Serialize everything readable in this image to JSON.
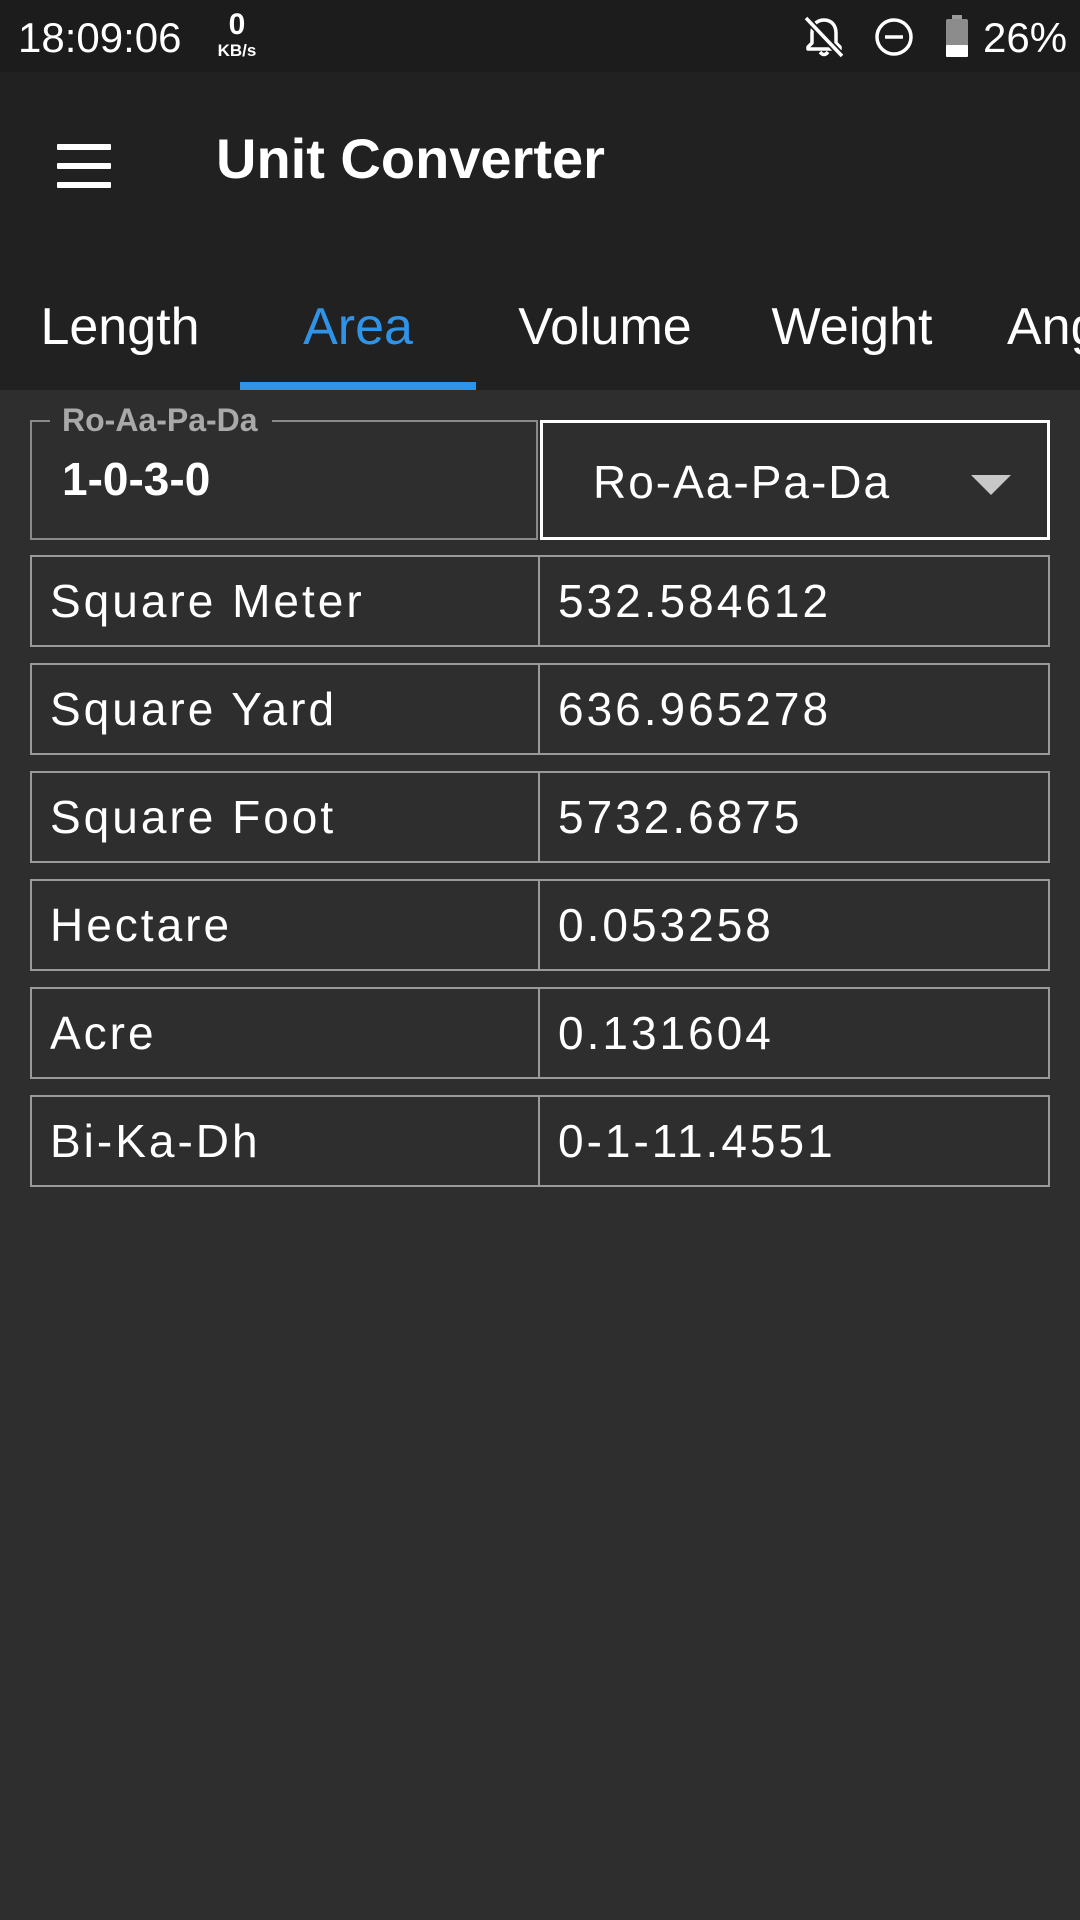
{
  "status_bar": {
    "time": "18:09:06",
    "net_speed_value": "0",
    "net_speed_unit": "KB/s",
    "icons": [
      "notifications-off-icon",
      "do-not-disturb-icon",
      "battery-icon"
    ],
    "battery_percent": "26%"
  },
  "app_bar": {
    "title": "Unit Converter",
    "menu_icon": "hamburger-menu-icon"
  },
  "tabs": [
    {
      "label": "Length",
      "active": false
    },
    {
      "label": "Area",
      "active": true
    },
    {
      "label": "Volume",
      "active": false
    },
    {
      "label": "Weight",
      "active": false
    },
    {
      "label": "Angle",
      "active": false
    }
  ],
  "input": {
    "label": "Ro-Aa-Pa-Da",
    "value": "1-0-3-0"
  },
  "unit_select": {
    "selected": "Ro-Aa-Pa-Da",
    "arrow_icon": "dropdown-arrow-icon"
  },
  "results": [
    {
      "unit": "Square Meter",
      "value": "532.584612"
    },
    {
      "unit": "Square Yard",
      "value": "636.965278"
    },
    {
      "unit": "Square Foot",
      "value": "5732.6875"
    },
    {
      "unit": "Hectare",
      "value": "0.053258"
    },
    {
      "unit": "Acre",
      "value": "0.131604"
    },
    {
      "unit": "Bi-Ka-Dh",
      "value": "0-1-11.4551"
    }
  ],
  "colors": {
    "status_bar_bg": "#1c1c1c",
    "app_bar_bg": "#212121",
    "content_bg": "#2e2e2e",
    "accent": "#2f94e8",
    "border": "#9a9a9a"
  }
}
